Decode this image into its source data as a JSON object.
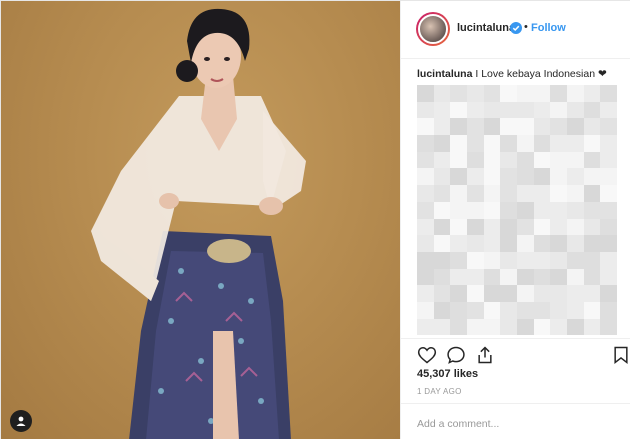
{
  "profile": {
    "username": "lucintaluna",
    "dot": "•",
    "follow_label": "Follow"
  },
  "caption": {
    "username": "lucintaluna",
    "text": "I Love kebaya Indonesian ❤"
  },
  "stats": {
    "likes": "45,307 likes",
    "posted": "1 DAY AGO"
  },
  "comment_box": {
    "placeholder": "Add a comment..."
  },
  "icons": {
    "verified": "verified-badge-icon",
    "like": "heart-icon",
    "comment": "speech-bubble-icon",
    "share": "share-icon",
    "save": "bookmark-icon",
    "user_tag": "user-tag-icon"
  },
  "colors": {
    "accent": "#3897f0",
    "text": "#262626",
    "muted": "#999999",
    "border": "#efefef",
    "photo_backdrop": "#b68c50"
  }
}
